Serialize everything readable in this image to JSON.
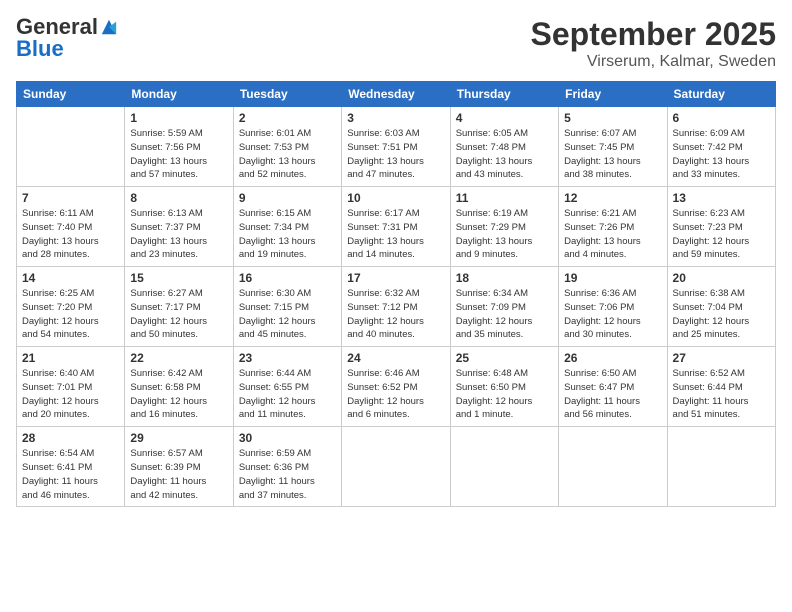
{
  "logo": {
    "general": "General",
    "blue": "Blue"
  },
  "header": {
    "month": "September 2025",
    "location": "Virserum, Kalmar, Sweden"
  },
  "weekdays": [
    "Sunday",
    "Monday",
    "Tuesday",
    "Wednesday",
    "Thursday",
    "Friday",
    "Saturday"
  ],
  "weeks": [
    [
      {
        "day": "",
        "sunrise": "",
        "sunset": "",
        "daylight": ""
      },
      {
        "day": "1",
        "sunrise": "Sunrise: 5:59 AM",
        "sunset": "Sunset: 7:56 PM",
        "daylight": "Daylight: 13 hours and 57 minutes."
      },
      {
        "day": "2",
        "sunrise": "Sunrise: 6:01 AM",
        "sunset": "Sunset: 7:53 PM",
        "daylight": "Daylight: 13 hours and 52 minutes."
      },
      {
        "day": "3",
        "sunrise": "Sunrise: 6:03 AM",
        "sunset": "Sunset: 7:51 PM",
        "daylight": "Daylight: 13 hours and 47 minutes."
      },
      {
        "day": "4",
        "sunrise": "Sunrise: 6:05 AM",
        "sunset": "Sunset: 7:48 PM",
        "daylight": "Daylight: 13 hours and 43 minutes."
      },
      {
        "day": "5",
        "sunrise": "Sunrise: 6:07 AM",
        "sunset": "Sunset: 7:45 PM",
        "daylight": "Daylight: 13 hours and 38 minutes."
      },
      {
        "day": "6",
        "sunrise": "Sunrise: 6:09 AM",
        "sunset": "Sunset: 7:42 PM",
        "daylight": "Daylight: 13 hours and 33 minutes."
      }
    ],
    [
      {
        "day": "7",
        "sunrise": "Sunrise: 6:11 AM",
        "sunset": "Sunset: 7:40 PM",
        "daylight": "Daylight: 13 hours and 28 minutes."
      },
      {
        "day": "8",
        "sunrise": "Sunrise: 6:13 AM",
        "sunset": "Sunset: 7:37 PM",
        "daylight": "Daylight: 13 hours and 23 minutes."
      },
      {
        "day": "9",
        "sunrise": "Sunrise: 6:15 AM",
        "sunset": "Sunset: 7:34 PM",
        "daylight": "Daylight: 13 hours and 19 minutes."
      },
      {
        "day": "10",
        "sunrise": "Sunrise: 6:17 AM",
        "sunset": "Sunset: 7:31 PM",
        "daylight": "Daylight: 13 hours and 14 minutes."
      },
      {
        "day": "11",
        "sunrise": "Sunrise: 6:19 AM",
        "sunset": "Sunset: 7:29 PM",
        "daylight": "Daylight: 13 hours and 9 minutes."
      },
      {
        "day": "12",
        "sunrise": "Sunrise: 6:21 AM",
        "sunset": "Sunset: 7:26 PM",
        "daylight": "Daylight: 13 hours and 4 minutes."
      },
      {
        "day": "13",
        "sunrise": "Sunrise: 6:23 AM",
        "sunset": "Sunset: 7:23 PM",
        "daylight": "Daylight: 12 hours and 59 minutes."
      }
    ],
    [
      {
        "day": "14",
        "sunrise": "Sunrise: 6:25 AM",
        "sunset": "Sunset: 7:20 PM",
        "daylight": "Daylight: 12 hours and 54 minutes."
      },
      {
        "day": "15",
        "sunrise": "Sunrise: 6:27 AM",
        "sunset": "Sunset: 7:17 PM",
        "daylight": "Daylight: 12 hours and 50 minutes."
      },
      {
        "day": "16",
        "sunrise": "Sunrise: 6:30 AM",
        "sunset": "Sunset: 7:15 PM",
        "daylight": "Daylight: 12 hours and 45 minutes."
      },
      {
        "day": "17",
        "sunrise": "Sunrise: 6:32 AM",
        "sunset": "Sunset: 7:12 PM",
        "daylight": "Daylight: 12 hours and 40 minutes."
      },
      {
        "day": "18",
        "sunrise": "Sunrise: 6:34 AM",
        "sunset": "Sunset: 7:09 PM",
        "daylight": "Daylight: 12 hours and 35 minutes."
      },
      {
        "day": "19",
        "sunrise": "Sunrise: 6:36 AM",
        "sunset": "Sunset: 7:06 PM",
        "daylight": "Daylight: 12 hours and 30 minutes."
      },
      {
        "day": "20",
        "sunrise": "Sunrise: 6:38 AM",
        "sunset": "Sunset: 7:04 PM",
        "daylight": "Daylight: 12 hours and 25 minutes."
      }
    ],
    [
      {
        "day": "21",
        "sunrise": "Sunrise: 6:40 AM",
        "sunset": "Sunset: 7:01 PM",
        "daylight": "Daylight: 12 hours and 20 minutes."
      },
      {
        "day": "22",
        "sunrise": "Sunrise: 6:42 AM",
        "sunset": "Sunset: 6:58 PM",
        "daylight": "Daylight: 12 hours and 16 minutes."
      },
      {
        "day": "23",
        "sunrise": "Sunrise: 6:44 AM",
        "sunset": "Sunset: 6:55 PM",
        "daylight": "Daylight: 12 hours and 11 minutes."
      },
      {
        "day": "24",
        "sunrise": "Sunrise: 6:46 AM",
        "sunset": "Sunset: 6:52 PM",
        "daylight": "Daylight: 12 hours and 6 minutes."
      },
      {
        "day": "25",
        "sunrise": "Sunrise: 6:48 AM",
        "sunset": "Sunset: 6:50 PM",
        "daylight": "Daylight: 12 hours and 1 minute."
      },
      {
        "day": "26",
        "sunrise": "Sunrise: 6:50 AM",
        "sunset": "Sunset: 6:47 PM",
        "daylight": "Daylight: 11 hours and 56 minutes."
      },
      {
        "day": "27",
        "sunrise": "Sunrise: 6:52 AM",
        "sunset": "Sunset: 6:44 PM",
        "daylight": "Daylight: 11 hours and 51 minutes."
      }
    ],
    [
      {
        "day": "28",
        "sunrise": "Sunrise: 6:54 AM",
        "sunset": "Sunset: 6:41 PM",
        "daylight": "Daylight: 11 hours and 46 minutes."
      },
      {
        "day": "29",
        "sunrise": "Sunrise: 6:57 AM",
        "sunset": "Sunset: 6:39 PM",
        "daylight": "Daylight: 11 hours and 42 minutes."
      },
      {
        "day": "30",
        "sunrise": "Sunrise: 6:59 AM",
        "sunset": "Sunset: 6:36 PM",
        "daylight": "Daylight: 11 hours and 37 minutes."
      },
      {
        "day": "",
        "sunrise": "",
        "sunset": "",
        "daylight": ""
      },
      {
        "day": "",
        "sunrise": "",
        "sunset": "",
        "daylight": ""
      },
      {
        "day": "",
        "sunrise": "",
        "sunset": "",
        "daylight": ""
      },
      {
        "day": "",
        "sunrise": "",
        "sunset": "",
        "daylight": ""
      }
    ]
  ]
}
